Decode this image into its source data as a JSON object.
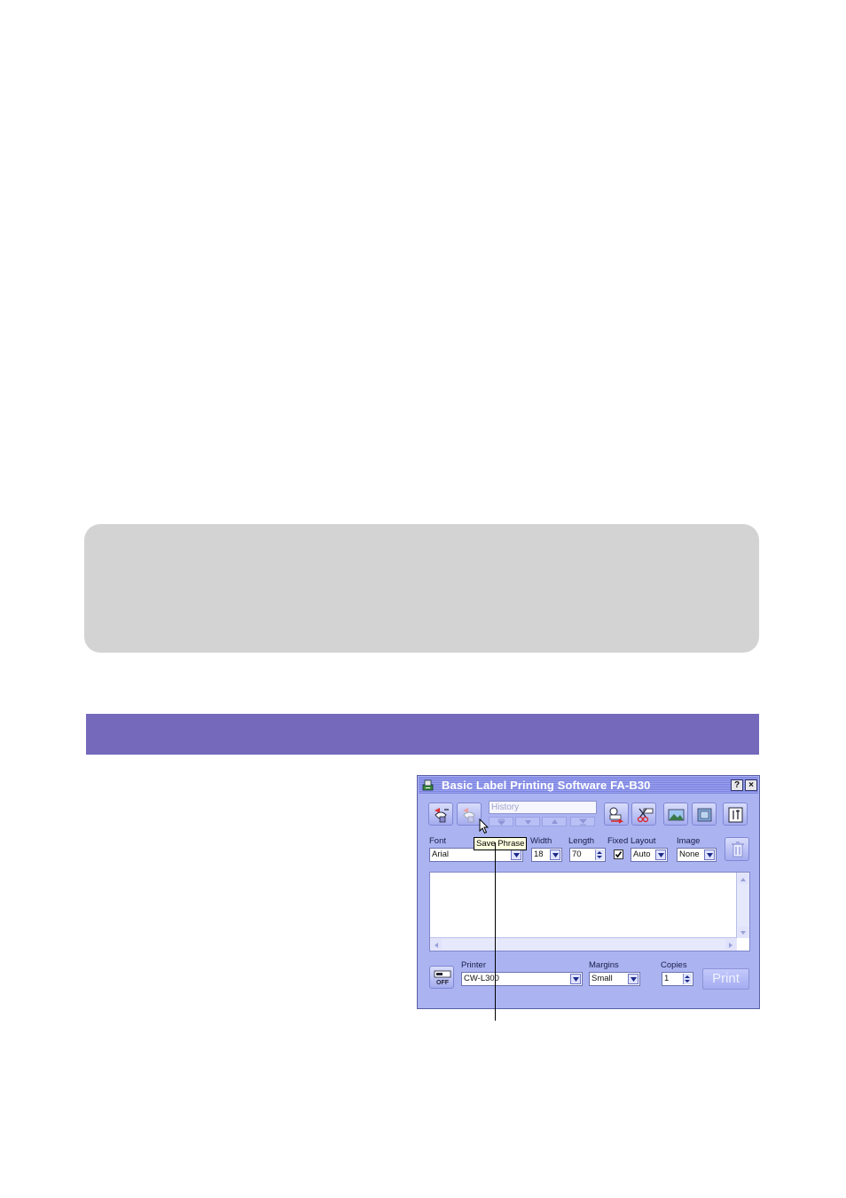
{
  "window": {
    "title": "Basic Label Printing Software FA-B30",
    "help_button": "?",
    "close_button": "×"
  },
  "toolbar": {
    "history_placeholder": "History"
  },
  "tooltip": {
    "text": "Save Phrase"
  },
  "format": {
    "font_label": "Font",
    "font_value": "Arial",
    "width_label": "Width",
    "width_value": "18",
    "length_label": "Length",
    "length_value": "70",
    "fixed_label": "Fixed",
    "fixed_checked": true,
    "layout_label": "Layout",
    "layout_value": "Auto",
    "image_label": "Image",
    "image_value": "None"
  },
  "print_section": {
    "printer_label": "Printer",
    "printer_value": "CW-L300",
    "margins_label": "Margins",
    "margins_value": "Small",
    "copies_label": "Copies",
    "copies_value": "1",
    "print_button": "Print",
    "power_label": "OFF"
  },
  "colors": {
    "section_bar": "#7469bb",
    "note_box": "#d3d3d3",
    "window_bg": "#abb4f1"
  }
}
